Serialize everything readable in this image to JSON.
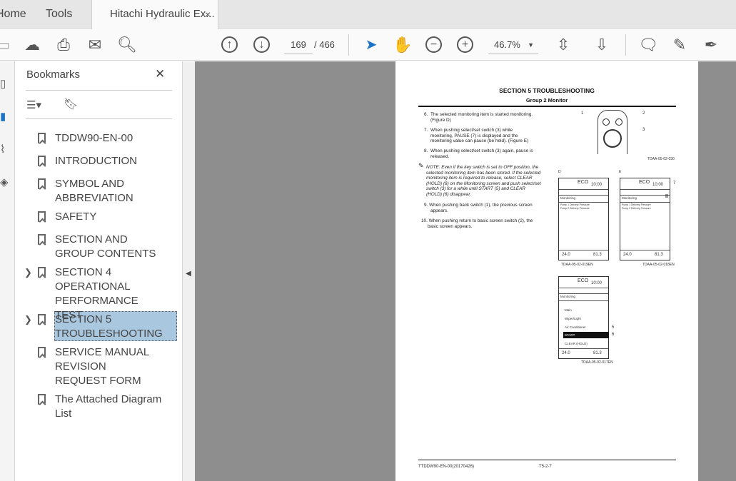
{
  "tabs": {
    "home": "Home",
    "tools": "Tools",
    "document": "Hitachi Hydraulic Ex...",
    "close": "×"
  },
  "toolbar": {
    "page_current": "169",
    "page_total": "/ 466",
    "zoom": "46.7%"
  },
  "bookmarks": {
    "title": "Bookmarks",
    "close": "✕",
    "items": [
      {
        "label": "TDDW90-EN-00",
        "expandable": false
      },
      {
        "label": "INTRODUCTION",
        "expandable": false
      },
      {
        "label": "SYMBOL AND ABBREVIATION",
        "expandable": false
      },
      {
        "label": "SAFETY",
        "expandable": false
      },
      {
        "label": "SECTION AND GROUP CONTENTS",
        "expandable": false
      },
      {
        "label": "SECTION 4 OPERATIONAL PERFORMANCE TEST",
        "expandable": true
      },
      {
        "label": "SECTION 5 TROUBLESHOOTING",
        "expandable": true,
        "selected": true
      },
      {
        "label": "SERVICE MANUAL REVISION REQUEST FORM",
        "expandable": false
      },
      {
        "label": "The Attached Diagram List",
        "expandable": false
      }
    ]
  },
  "doc": {
    "section": "SECTION 5 TROUBLESHOOTING",
    "group": "Group 2 Monitor",
    "steps": [
      {
        "n": "6.",
        "text": "The selected monitoring item is started monitoring. (Figure D)"
      },
      {
        "n": "7.",
        "text": "When pushing select/set switch (3) while monitoring, PAUSE (7) is displayed and the monitoring value can pause (be held). (Figure E)"
      },
      {
        "n": "8.",
        "text": "When pushing select/set switch (3) again, pause is released."
      },
      {
        "n": "9.",
        "text": "When pushing back switch (1), the previous screen appears."
      },
      {
        "n": "10.",
        "text": "When pushing return to basic screen switch (2), the basic screen appears."
      }
    ],
    "note": "NOTE:   Even if the key switch is set to OFF position, the selected monitoring item has been stored. If the selected monitoring item is required to release, select CLEAR (HOLD) (6) on the Monitoring screen and push select/set switch (3) for a while until START (5) and CLEAR (HOLD) (6) disappear.",
    "fig1_caption": "TDAA-05-02-030",
    "fig1_labels": [
      "1",
      "2",
      "3"
    ],
    "figD": {
      "label": "D",
      "caption": "TDAA-05-02-019EN"
    },
    "figE": {
      "label": "E",
      "caption": "TDAA-05-02-018EN",
      "callout": "7"
    },
    "figF": {
      "caption": "TDAA-05-02-017EN",
      "callouts": [
        "5",
        "6"
      ],
      "menu": [
        "Main",
        "Wiper/Light",
        "Air Conditioner",
        "START",
        "CLEAR (HOLD)"
      ]
    },
    "monitor": {
      "eco": "ECO",
      "time": "10:00",
      "title": "Monitoring",
      "rows": [
        "Pump 1 Delivery Pressure",
        "Pump 2 Delivery Pressure"
      ],
      "temp": "24.0",
      "hours": "81.3"
    },
    "footer_left": "TTDDW90-EN-00(20170426)",
    "footer_page": "T5-2-7"
  }
}
